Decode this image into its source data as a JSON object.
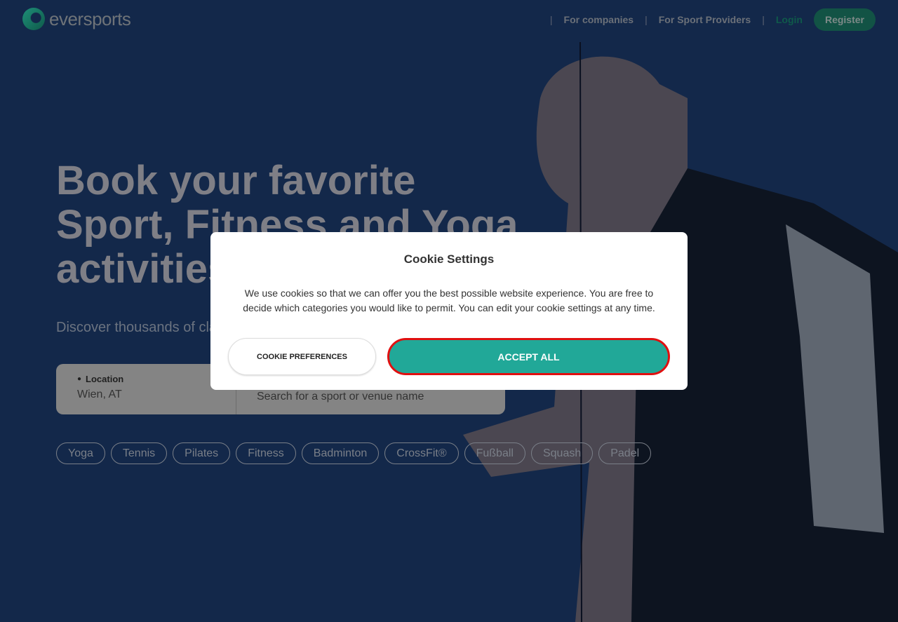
{
  "nav": {
    "logo_text": "eversports",
    "for_companies": "For companies",
    "for_providers": "For Sport Providers",
    "login": "Login",
    "register": "Register"
  },
  "hero": {
    "headline": "Book your favorite Sport, Fitness and Yoga activities",
    "subtitle": "Discover thousands of cla",
    "location_label": "Location",
    "location_value": "Wien, AT",
    "search_placeholder": "Search for a sport or venue name",
    "chips": [
      "Yoga",
      "Tennis",
      "Pilates",
      "Fitness",
      "Badminton",
      "CrossFit®",
      "Fußball",
      "Squash",
      "Padel"
    ]
  },
  "cookie": {
    "title": "Cookie Settings",
    "text": "We use cookies so that we can offer you the best possible website experience. You are free to decide which categories you would like to permit. You can edit your cookie settings at any time.",
    "preferences": "COOKIE PREFERENCES",
    "accept": "ACCEPT ALL"
  },
  "colors": {
    "background": "#13284a",
    "accent": "#21a898",
    "highlight": "#e01010"
  }
}
